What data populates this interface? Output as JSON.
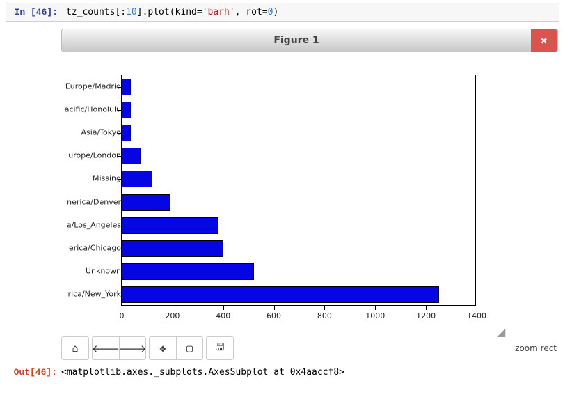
{
  "chart_data": {
    "type": "bar",
    "orientation": "horizontal",
    "title": "",
    "xlabel": "",
    "ylabel": "",
    "xlim": [
      0,
      1400
    ],
    "categories": [
      "Europe/Madrid",
      "acific/Honolulu",
      "Asia/Tokyo",
      "urope/London",
      "Missing",
      "nerica/Denver",
      "a/Los_Angeles",
      "erica/Chicago",
      "Unknown",
      "rica/New_York"
    ],
    "values": [
      35,
      36,
      37,
      74,
      120,
      191,
      382,
      400,
      521,
      1251
    ],
    "x_ticks": [
      0,
      200,
      400,
      600,
      800,
      1000,
      1200,
      1400
    ]
  },
  "input": {
    "prompt": "In [46]:",
    "code_pre": "tz_counts[:",
    "code_num": "10",
    "code_mid": "].plot(kind=",
    "code_str": "'barh'",
    "code_post": ", rot=",
    "code_num2": "0",
    "code_end": ")"
  },
  "figure": {
    "title": "Figure 1",
    "close_glyph": "✖"
  },
  "toolbar": {
    "home_glyph": "⌂",
    "back_glyph": "🡐",
    "fwd_glyph": "🡒",
    "pan_glyph": "✥",
    "zoom_glyph": "▢",
    "save_glyph": "🖫",
    "status": "zoom rect"
  },
  "output": {
    "prompt": "Out[46]:",
    "text": "<matplotlib.axes._subplots.AxesSubplot at 0x4aaccf8>"
  }
}
